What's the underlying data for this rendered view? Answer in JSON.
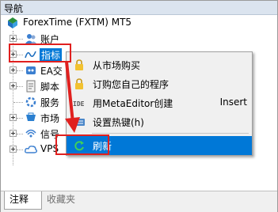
{
  "panel": {
    "title": "导航"
  },
  "tree": {
    "root": {
      "label": "ForexTime (FXTM) MT5",
      "icon": "mt5-icon"
    },
    "items": [
      {
        "label": "账户",
        "icon": "accounts-icon"
      },
      {
        "label": "指标",
        "icon": "indicator-icon"
      },
      {
        "label": "EA交",
        "icon": "expert-icon"
      },
      {
        "label": "脚本",
        "icon": "script-icon"
      },
      {
        "label": "服务",
        "icon": "service-icon"
      },
      {
        "label": "市场",
        "icon": "market-icon"
      },
      {
        "label": "信号",
        "icon": "signal-icon"
      },
      {
        "label": "VPS",
        "icon": "vps-icon"
      }
    ]
  },
  "context_menu": {
    "items": [
      {
        "label": "从市场购买",
        "shortcut": "",
        "icon": "lock-icon"
      },
      {
        "label": "订购您自己的程序",
        "shortcut": "",
        "icon": "lock-icon"
      },
      {
        "label": "用MetaEditor创建",
        "shortcut": "Insert",
        "icon": "metaeditor-icon"
      },
      {
        "label": "设置热键(h)",
        "shortcut": "",
        "icon": "keyboard-icon"
      },
      {
        "label": "刷新",
        "shortcut": "",
        "icon": "refresh-icon"
      }
    ]
  },
  "tabs": [
    {
      "label": "注释",
      "active": true
    },
    {
      "label": "收藏夹",
      "active": false
    }
  ],
  "colors": {
    "selection": "#0078d7",
    "annotation": "#e0201f",
    "titlebar": "#dbe4ef"
  }
}
